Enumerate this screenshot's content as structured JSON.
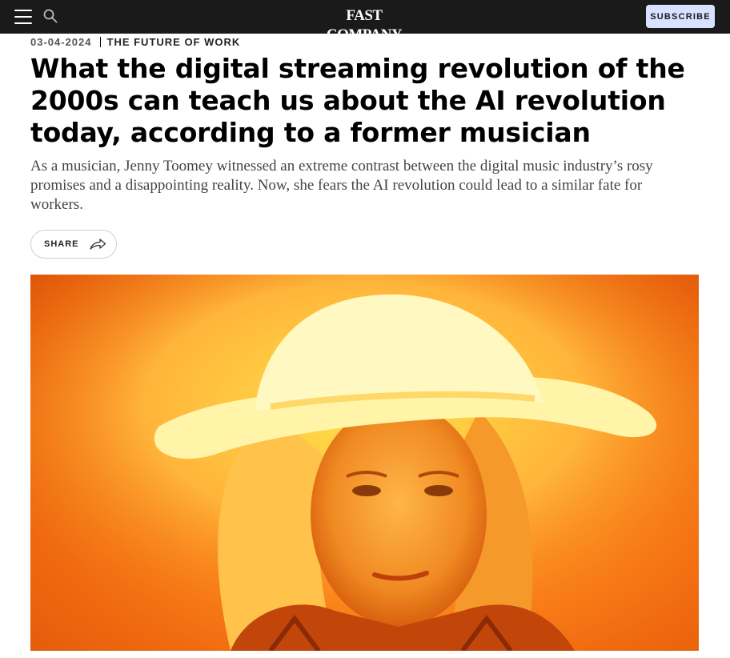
{
  "header": {
    "logo_text": "FAST COMPANY",
    "subscribe_label": "SUBSCRIBE",
    "menu_icon": "hamburger-menu-icon",
    "search_icon": "search-icon",
    "background_color": "#1a1a1a",
    "subscribe_color": "#d8e1ff"
  },
  "article": {
    "date": "03-04-2024",
    "category": "THE FUTURE OF WORK",
    "headline": "What the digital streaming revolution of the 2000s can teach us about the AI revolution today, according to a former musician",
    "dek": "As a musician, Jenny Toomey witnessed an extreme contrast between the digital music industry’s rosy promises and a disappointing reality. Now, she fears the AI revolution could lead to a similar fate for workers.",
    "share_label": "SHARE",
    "share_icon": "share-arrow-icon",
    "hero_image": "portrait-woman-cowboy-hat-orange-duotone"
  }
}
